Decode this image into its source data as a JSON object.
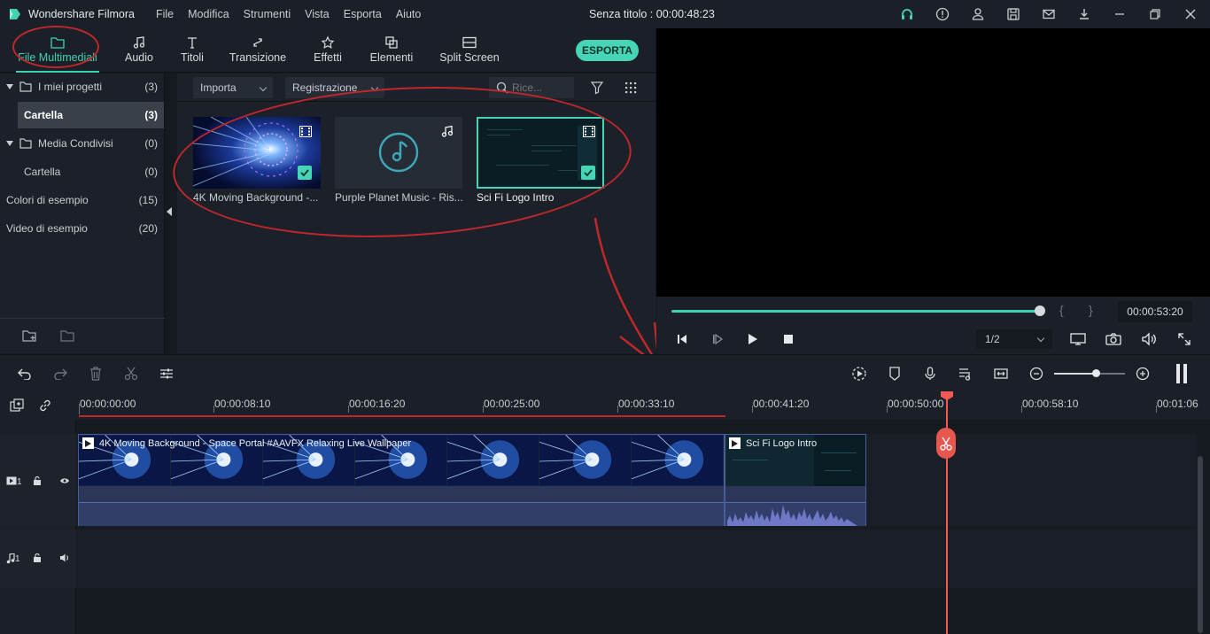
{
  "app": {
    "name": "Wondershare Filmora",
    "document_title": "Senza titolo : 00:00:48:23",
    "menu": [
      "File",
      "Modifica",
      "Strumenti",
      "Vista",
      "Esporta",
      "Aiuto"
    ]
  },
  "tabs": [
    {
      "label": "File Multimediali",
      "icon": "folder-icon",
      "active": true
    },
    {
      "label": "Audio",
      "icon": "music-note-icon"
    },
    {
      "label": "Titoli",
      "icon": "text-icon"
    },
    {
      "label": "Transizione",
      "icon": "transition-icon"
    },
    {
      "label": "Effetti",
      "icon": "effects-icon"
    },
    {
      "label": "Elementi",
      "icon": "elements-icon"
    },
    {
      "label": "Split Screen",
      "icon": "split-screen-icon"
    }
  ],
  "export_label": "ESPORTA",
  "sidebar": {
    "items": [
      {
        "label": "I miei progetti",
        "count": "(3)"
      },
      {
        "label": "Cartella",
        "count": "(3)"
      },
      {
        "label": "Media Condivisi",
        "count": "(0)"
      },
      {
        "label": "Cartella",
        "count": "(0)"
      },
      {
        "label": "Colori di esempio",
        "count": "(15)"
      },
      {
        "label": "Video di esempio",
        "count": "(20)"
      }
    ]
  },
  "media_toolbar": {
    "import_label": "Importa",
    "record_label": "Registrazione",
    "search_placeholder": "Rice..."
  },
  "media_items": [
    {
      "label": "4K Moving Background -...",
      "type": "video",
      "selected": false
    },
    {
      "label": "Purple Planet Music - Ris...",
      "type": "audio",
      "selected": false
    },
    {
      "label": "Sci Fi Logo Intro",
      "type": "video",
      "selected": true
    }
  ],
  "preview": {
    "timecode": "00:00:53:20",
    "ratio": "1/2",
    "progress": 1.0,
    "brace_open": "{",
    "brace_close": "}"
  },
  "ruler_labels": [
    "00:00:00:00",
    "00:00:08:10",
    "00:00:16:20",
    "00:00:25:00",
    "00:00:33:10",
    "00:00:41:20",
    "00:00:50:00",
    "00:00:58:10",
    "00:01:06"
  ],
  "clips": {
    "clip1_title": "4K Moving Background - Space Portal #AAVFX Relaxing Live Wallpaper",
    "clip2_title": "Sci Fi Logo Intro"
  },
  "track_heads": {
    "video": "1",
    "audio": "1"
  },
  "colors": {
    "accent": "#46d6b5",
    "playhead": "#f05a53",
    "annotation": "#c0272d"
  }
}
